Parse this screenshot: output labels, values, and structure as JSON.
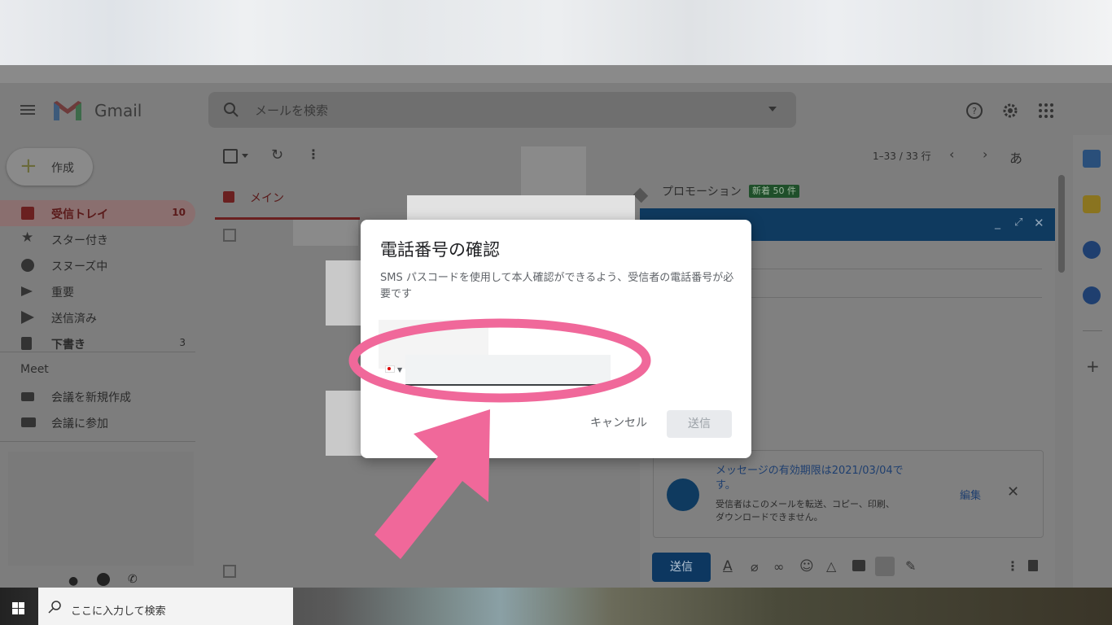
{
  "gmail": {
    "logo_text": "Gmail",
    "search_placeholder": "メールを検索",
    "compose_label": "作成",
    "pagination": "1–33 / 33 行",
    "input_tool": "あ",
    "sidebar": [
      {
        "label": "受信トレイ",
        "count": "10",
        "active": true
      },
      {
        "label": "スター付き",
        "count": ""
      },
      {
        "label": "スヌーズ中",
        "count": ""
      },
      {
        "label": "重要",
        "count": ""
      },
      {
        "label": "送信済み",
        "count": ""
      },
      {
        "label": "下書き",
        "count": "3"
      }
    ],
    "meet": {
      "header": "Meet",
      "new_meeting": "会議を新規作成",
      "join_meeting": "会議に参加"
    },
    "tabs": {
      "main": "メイン",
      "promotions": "プロモーション",
      "promotions_badge": "新着 50 件"
    }
  },
  "compose": {
    "confidential_title": "メッセージの有効期限は2021/03/04です。",
    "confidential_desc": "受信者はこのメールを転送、コピー、印刷、ダウンロードできません。",
    "edit_link": "編集",
    "send_label": "送信"
  },
  "dialog": {
    "title": "電話番号の確認",
    "description": "SMS パスコードを使用して本人確認ができるよう、受信者の電話番号が必要です",
    "phone_value": "",
    "cancel_label": "キャンセル",
    "send_label": "送信"
  },
  "taskbar": {
    "search_placeholder": "ここに入力して検索"
  },
  "colors": {
    "annotation": "#f0689a",
    "compose_header": "#0f3a5f",
    "dialog_bg": "#ffffff"
  }
}
